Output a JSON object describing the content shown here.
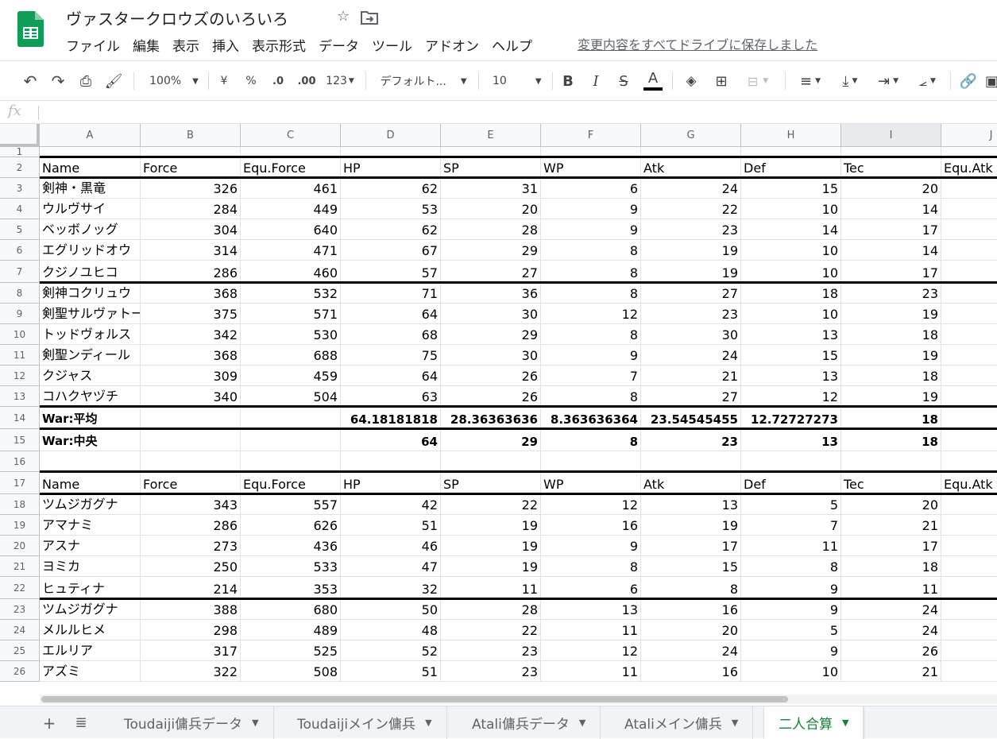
{
  "app": {
    "doc_title": "ヴァスタークロウズのいろいろ",
    "menu": [
      "ファイル",
      "編集",
      "表示",
      "挿入",
      "表示形式",
      "データ",
      "ツール",
      "アドオン",
      "ヘルプ"
    ],
    "saved_status": "変更内容をすべてドライブに保存しました",
    "brand_color": "#0f9d58"
  },
  "toolbar": {
    "zoom": "100%",
    "currency": "¥",
    "percent": "%",
    "dec_less": ".0",
    "dec_more": ".00",
    "format_more": "123",
    "font": "デフォルト...",
    "font_size": "10",
    "bold": "B",
    "italic": "I",
    "strike": "S",
    "text_color": "A"
  },
  "formula_bar": {
    "fx": "fx",
    "value": ""
  },
  "grid": {
    "columns": [
      "A",
      "B",
      "C",
      "D",
      "E",
      "F",
      "G",
      "H",
      "I",
      "J"
    ],
    "row_numbers": [
      "1",
      "2",
      "3",
      "4",
      "5",
      "6",
      "7",
      "8",
      "9",
      "10",
      "11",
      "12",
      "13",
      "14",
      "15",
      "16",
      "17",
      "18",
      "19",
      "20",
      "21",
      "22",
      "23",
      "24",
      "25",
      "26"
    ],
    "rows": [
      [
        "",
        "",
        "",
        "",
        "",
        "",
        "",
        "",
        "",
        ""
      ],
      [
        "Name",
        "Force",
        "Equ.Force",
        "HP",
        "SP",
        "WP",
        "Atk",
        "Def",
        "Tec",
        "Equ.Atk"
      ],
      [
        "剣神・黒竜",
        "326",
        "461",
        "62",
        "31",
        "6",
        "24",
        "15",
        "20",
        ""
      ],
      [
        "ウルヴサイ",
        "284",
        "449",
        "53",
        "20",
        "9",
        "22",
        "10",
        "14",
        ""
      ],
      [
        "ベッボノッグ",
        "304",
        "640",
        "62",
        "28",
        "9",
        "23",
        "14",
        "17",
        ""
      ],
      [
        "エグリッドオウ",
        "314",
        "471",
        "67",
        "29",
        "8",
        "19",
        "10",
        "14",
        ""
      ],
      [
        "クジノユヒコ",
        "286",
        "460",
        "57",
        "27",
        "8",
        "19",
        "10",
        "17",
        ""
      ],
      [
        "剣神コクリュウ",
        "368",
        "532",
        "71",
        "36",
        "8",
        "27",
        "18",
        "23",
        ""
      ],
      [
        "剣聖サルヴァトー",
        "375",
        "571",
        "64",
        "30",
        "12",
        "23",
        "10",
        "19",
        ""
      ],
      [
        "トッドヴォルス",
        "342",
        "530",
        "68",
        "29",
        "8",
        "30",
        "13",
        "18",
        ""
      ],
      [
        "剣聖ンディール",
        "368",
        "688",
        "75",
        "30",
        "9",
        "24",
        "15",
        "19",
        ""
      ],
      [
        "クジャス",
        "309",
        "459",
        "64",
        "26",
        "7",
        "21",
        "13",
        "18",
        ""
      ],
      [
        "コハクヤヅチ",
        "340",
        "504",
        "63",
        "26",
        "8",
        "27",
        "12",
        "19",
        ""
      ],
      [
        "War:平均",
        "",
        "",
        "64.18181818",
        "28.36363636",
        "8.363636364",
        "23.54545455",
        "12.72727273",
        "18",
        ""
      ],
      [
        "War:中央",
        "",
        "",
        "64",
        "29",
        "8",
        "23",
        "13",
        "18",
        ""
      ],
      [
        "",
        "",
        "",
        "",
        "",
        "",
        "",
        "",
        "",
        ""
      ],
      [
        "Name",
        "Force",
        "Equ.Force",
        "HP",
        "SP",
        "WP",
        "Atk",
        "Def",
        "Tec",
        "Equ.Atk"
      ],
      [
        "ツムジガグナ",
        "343",
        "557",
        "42",
        "22",
        "12",
        "13",
        "5",
        "20",
        ""
      ],
      [
        "アマナミ",
        "286",
        "626",
        "51",
        "19",
        "16",
        "19",
        "7",
        "21",
        ""
      ],
      [
        "アスナ",
        "273",
        "436",
        "46",
        "19",
        "9",
        "17",
        "11",
        "17",
        ""
      ],
      [
        "ヨミカ",
        "250",
        "533",
        "47",
        "19",
        "8",
        "15",
        "8",
        "18",
        ""
      ],
      [
        "ヒュティナ",
        "214",
        "353",
        "32",
        "11",
        "6",
        "8",
        "9",
        "11",
        ""
      ],
      [
        "ツムジガグナ",
        "388",
        "680",
        "50",
        "28",
        "13",
        "16",
        "9",
        "24",
        ""
      ],
      [
        "メルルヒメ",
        "298",
        "489",
        "48",
        "22",
        "11",
        "20",
        "5",
        "24",
        ""
      ],
      [
        "エルリア",
        "317",
        "525",
        "52",
        "23",
        "12",
        "24",
        "9",
        "26",
        ""
      ],
      [
        "アズミ",
        "322",
        "508",
        "51",
        "23",
        "11",
        "16",
        "10",
        "21",
        ""
      ]
    ]
  },
  "tabs": [
    {
      "label": "Toudaiji傭兵データ",
      "active": false
    },
    {
      "label": "Toudaijiメイン傭兵",
      "active": false
    },
    {
      "label": "Atali傭兵データ",
      "active": false
    },
    {
      "label": "Ataliメイン傭兵",
      "active": false
    },
    {
      "label": "二人合算",
      "active": true
    }
  ]
}
